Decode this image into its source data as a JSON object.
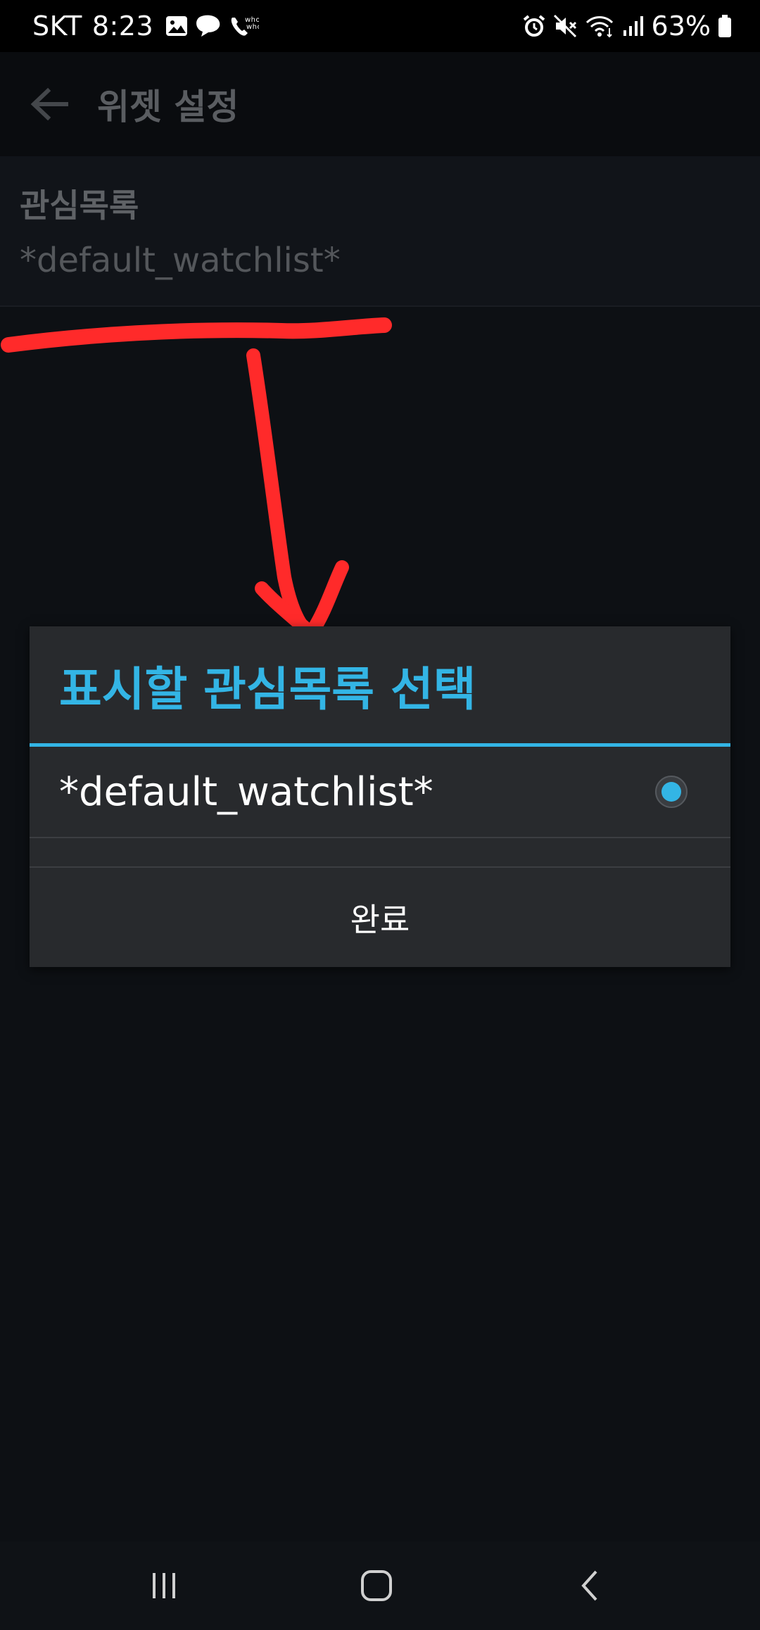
{
  "status_bar": {
    "carrier": "SKT",
    "time": "8:23",
    "battery_percent": "63%",
    "left_icons": [
      "gallery-icon",
      "chat-bubble-icon",
      "whowho-call-icon"
    ],
    "right_icons": [
      "alarm-icon",
      "mute-icon",
      "wifi-icon",
      "signal-icon",
      "battery-icon"
    ]
  },
  "app_bar": {
    "title": "위젯 설정",
    "back_icon": "arrow-left-icon"
  },
  "preference": {
    "title": "관심목록",
    "summary": "*default_watchlist*"
  },
  "dialog": {
    "title": "표시할 관심목록 선택",
    "accent_color": "#33b5e5",
    "options": [
      {
        "label": "*default_watchlist*",
        "selected": true
      }
    ],
    "done_label": "완료"
  },
  "annotation": {
    "color": "#ff2a2a",
    "shape": "underline-with-down-arrow"
  },
  "nav_bar": {
    "buttons": [
      "recent-apps-icon",
      "home-icon",
      "back-icon"
    ]
  }
}
